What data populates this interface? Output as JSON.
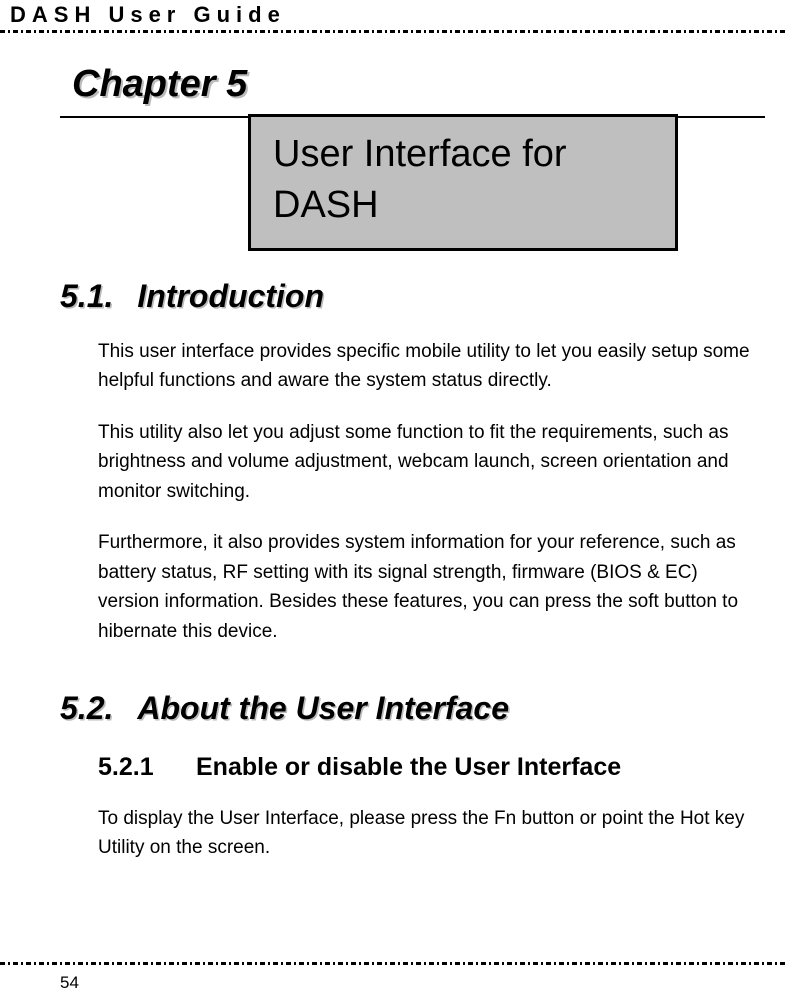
{
  "header": {
    "doc_title": "DASH User Guide"
  },
  "chapter": {
    "heading": "Chapter 5",
    "subtitle": "User Interface for DASH"
  },
  "sections": {
    "s1": {
      "number": "5.1.",
      "title": "Introduction",
      "paragraphs": [
        "This user interface provides specific mobile utility to let you easily setup some helpful functions and aware the system status directly.",
        "This utility also let you adjust some function to fit the requirements, such as brightness and volume adjustment, webcam launch, screen orientation and monitor switching.",
        "Furthermore, it also provides system information for your reference, such as battery status, RF setting with its signal strength, firmware (BIOS & EC) version information. Besides these features, you can press the soft button to hibernate this device."
      ]
    },
    "s2": {
      "number": "5.2.",
      "title": "About the User Interface",
      "subsections": {
        "ss1": {
          "number": "5.2.1",
          "title": "Enable or disable the User Interface",
          "paragraphs": [
            "To display the User Interface, please press the Fn button or point the Hot key Utility on the screen."
          ]
        }
      }
    }
  },
  "footer": {
    "page_number": "54"
  }
}
